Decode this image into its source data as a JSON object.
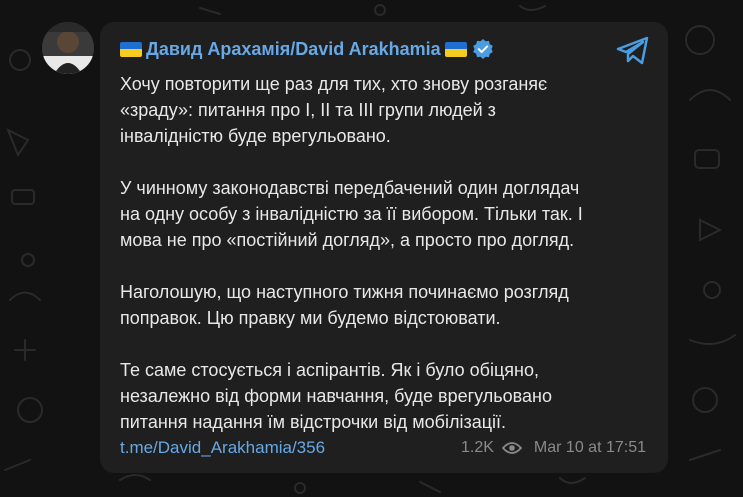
{
  "post": {
    "flag_left": "ukraine-flag",
    "flag_right": "ukraine-flag",
    "author": "Давид Арахамія/David Arakhamia",
    "verified_icon": "verified-badge-icon",
    "app_icon": "telegram-icon",
    "paragraphs": [
      "Хочу повторити ще раз для тих, хто знову розганяє\n«зраду»: питання про І, ІІ та ІІІ групи людей з\nінвалідністю буде врегульовано.",
      "У чинному законодавстві передбачений один доглядач\nна одну особу з інвалідністю за її вибором. Тільки так. І\nмова не про «постійний догляд», а просто про догляд.",
      "Наголошую, що наступного тижня починаємо розгляд\nпоправок. Цю правку ми будемо відстоювати.",
      "Те саме стосується і аспірантів. Як і було обіцяно,\nнезалежно від форми навчання, буде врегульовано\nпитання надання їм відстрочки від мобілізації."
    ],
    "link": "t.me/David_Arakhamia/356",
    "views": "1.2K",
    "date": "Mar 10 at 17:51"
  },
  "colors": {
    "background": "#121212",
    "bubble": "#1f1f1f",
    "accent": "#67a9e6",
    "text": "#e8e8e8",
    "muted": "#8a8a8a"
  }
}
